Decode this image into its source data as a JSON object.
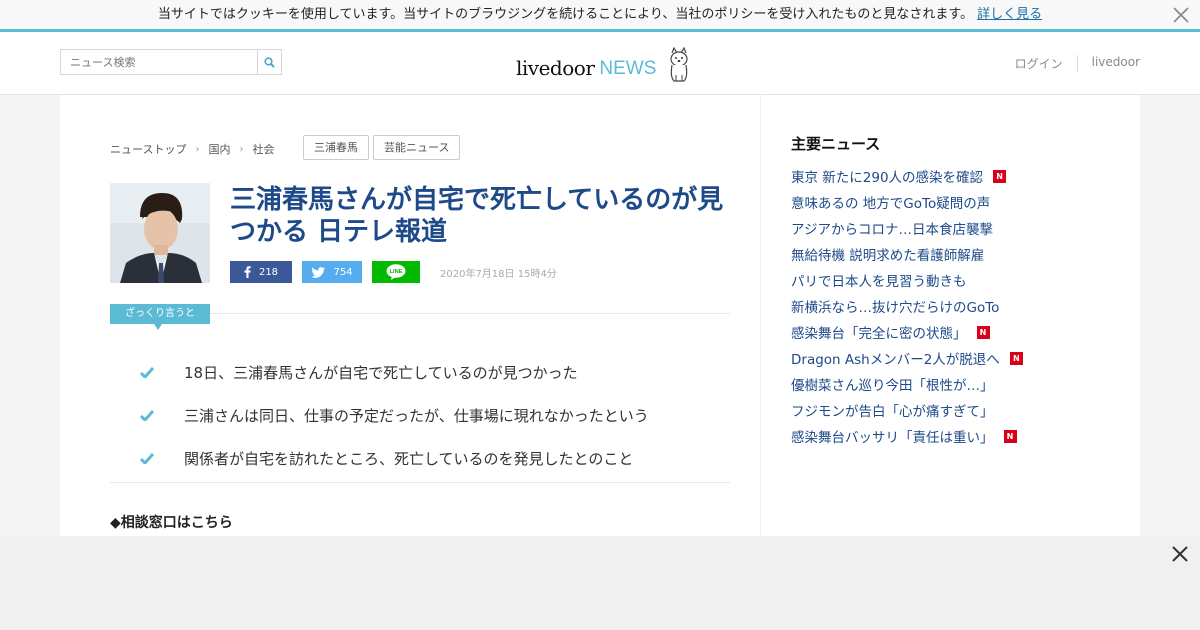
{
  "cookie": {
    "message": "当サイトではクッキーを使用しています。当サイトのブラウジングを続けることにより、当社のポリシーを受け入れたものと見なされます。",
    "link": "詳しく見る",
    "close_icon": "close-icon"
  },
  "header": {
    "search_placeholder": "ニュース検索",
    "search_icon": "search-icon",
    "logo_livedoor": "livedoor",
    "logo_news": "NEWS",
    "login": "ログイン",
    "livedoor_link": "livedoor"
  },
  "breadcrumb": {
    "items": [
      "ニューストップ",
      "国内",
      "社会"
    ],
    "separator": "›"
  },
  "tags": [
    "三浦春馬",
    "芸能ニュース"
  ],
  "article": {
    "title": "三浦春馬さんが自宅で死亡しているのが見つかる 日テレ報道",
    "facebook_count": "218",
    "twitter_count": "754",
    "line_label": "LINE",
    "date": "2020年7月18日 15時4分",
    "summary_label": "ざっくり言うと",
    "summary": [
      "18日、三浦春馬さんが自宅で死亡しているのが見つかった",
      "三浦さんは同日、仕事の予定だったが、仕事場に現れなかったという",
      "関係者が自宅を訪れたところ、死亡しているのを発見したとのこと"
    ],
    "consult_heading": "◆相談窓口はこちら"
  },
  "sidebar": {
    "title": "主要ニュース",
    "news": [
      {
        "text": "東京 新たに290人の感染を確認",
        "new": true
      },
      {
        "text": "意味あるの 地方でGoTo疑問の声",
        "new": false
      },
      {
        "text": "アジアからコロナ…日本食店襲撃",
        "new": false
      },
      {
        "text": "無給待機 説明求めた看護師解雇",
        "new": false
      },
      {
        "text": "パリで日本人を見習う動きも",
        "new": false
      },
      {
        "text": "新横浜なら…抜け穴だらけのGoTo",
        "new": false
      },
      {
        "text": "感染舞台「完全に密の状態」",
        "new": true
      },
      {
        "text": "Dragon Ashメンバー2人が脱退へ",
        "new": true
      },
      {
        "text": "優樹菜さん巡り今田「根性が…」",
        "new": false
      },
      {
        "text": "フジモンが告白「心が痛すぎて」",
        "new": false
      },
      {
        "text": "感染舞台バッサリ「責任は重い」",
        "new": true
      }
    ],
    "new_badge": "N"
  },
  "colors": {
    "accent": "#5bbbd4",
    "link": "#1e4a8a",
    "facebook": "#3b5998",
    "twitter": "#55acee",
    "line": "#00b900",
    "new_badge": "#d9001b"
  }
}
